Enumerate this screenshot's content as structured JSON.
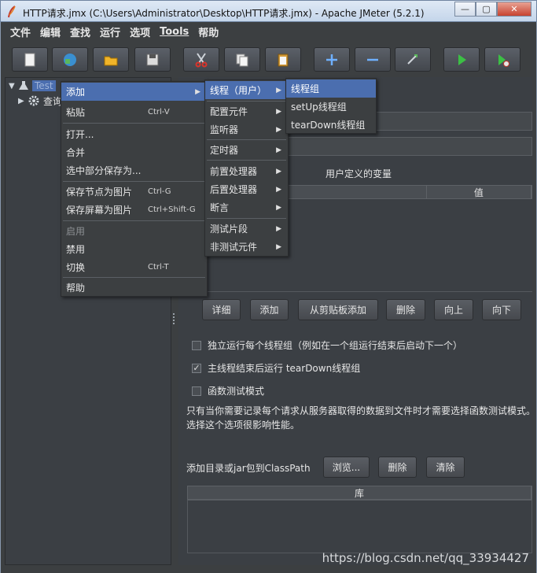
{
  "window": {
    "title": "HTTP请求.jmx (C:\\Users\\Administrator\\Desktop\\HTTP请求.jmx) - Apache JMeter (5.2.1)",
    "min": "—",
    "max": "▢",
    "close": "✕"
  },
  "menubar": [
    "文件",
    "编辑",
    "查找",
    "运行",
    "选项",
    "Tools",
    "帮助"
  ],
  "toolbar": [
    "new-icon",
    "templates-icon",
    "open-icon",
    "save-icon",
    "cut-icon",
    "copy-icon",
    "paste-icon",
    "expand-icon",
    "collapse-icon",
    "toggle-icon",
    "start-icon",
    "start-no-pauses-icon"
  ],
  "tree": {
    "root": "Test",
    "child": "查询"
  },
  "context_menu": {
    "items": [
      {
        "label": "添加",
        "submenu": true
      },
      {
        "label": "粘贴",
        "shortcut": "Ctrl-V"
      },
      {
        "label": "打开..."
      },
      {
        "label": "合并"
      },
      {
        "label": "选中部分保存为..."
      },
      {
        "label": "保存节点为图片",
        "shortcut": "Ctrl-G"
      },
      {
        "label": "保存屏幕为图片",
        "shortcut": "Ctrl+Shift-G"
      },
      {
        "label": "启用",
        "disabled": true
      },
      {
        "label": "禁用"
      },
      {
        "label": "切换",
        "shortcut": "Ctrl-T"
      },
      {
        "label": "帮助"
      }
    ]
  },
  "add_submenu": [
    "线程（用户）",
    "配置元件",
    "监听器",
    "定时器",
    "前置处理器",
    "后置处理器",
    "断言",
    "测试片段",
    "非测试元件"
  ],
  "thread_submenu": [
    "线程组",
    "setUp线程组",
    "tearDown线程组"
  ],
  "right": {
    "udv_title": "用户定义的变量",
    "col_value": "值",
    "buttons": [
      "详细",
      "添加",
      "从剪贴板添加",
      "删除",
      "向上",
      "向下"
    ],
    "checks": [
      {
        "label": "独立运行每个线程组（例如在一个组运行结束后启动下一个）",
        "checked": false
      },
      {
        "label": "主线程结束后运行 tearDown线程组",
        "checked": true
      },
      {
        "label": "函数测试模式",
        "checked": false
      }
    ],
    "note_line1": "只有当你需要记录每个请求从服务器取得的数据到文件时才需要选择函数测试模式。",
    "note_line2": "选择这个选项很影响性能。",
    "classpath_label": "添加目录或jar包到ClassPath",
    "classpath_buttons": [
      "浏览...",
      "删除",
      "清除"
    ],
    "lib_header": "库"
  },
  "watermark": "https://blog.csdn.net/qq_33934427"
}
